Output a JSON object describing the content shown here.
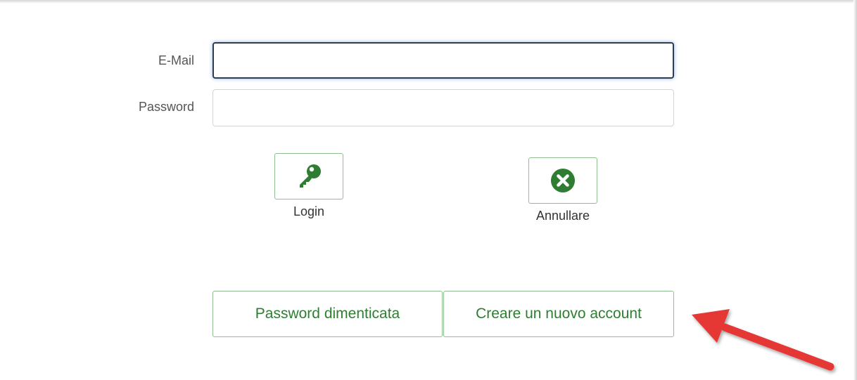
{
  "form": {
    "email_label": "E-Mail",
    "email_value": "",
    "password_label": "Password",
    "password_value": ""
  },
  "actions": {
    "login_label": "Login",
    "cancel_label": "Annullare"
  },
  "links": {
    "forgot_password_label": "Password dimenticata",
    "create_account_label": "Creare un nuovo account"
  },
  "icons": {
    "login": "key-icon",
    "cancel": "close-circle-icon",
    "annotation": "arrow-icon"
  },
  "colors": {
    "accent_green": "#2e7d32",
    "button_border": "#8fbf8f",
    "focus_border": "#2c3e50",
    "annotation_red": "#e53935"
  }
}
